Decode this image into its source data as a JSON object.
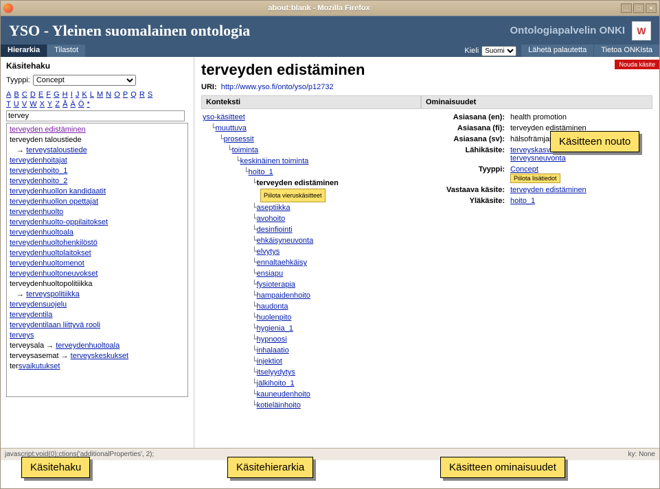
{
  "window": {
    "title": "about:blank - Mozilla Firefox"
  },
  "header": {
    "title": "YSO - Yleinen suomalainen ontologia",
    "server": "Ontologiapalvelin ONKI"
  },
  "nav": {
    "tabs": [
      {
        "label": "Hierarkia"
      },
      {
        "label": "Tilastot"
      }
    ],
    "lang_label": "Kieli",
    "lang_value": "Suomi",
    "right": [
      {
        "label": "Lähetä palautetta"
      },
      {
        "label": "Tietoa ONKIsta"
      }
    ]
  },
  "sidebar": {
    "title": "Käsitehaku",
    "type_label": "Tyyppi:",
    "type_value": "Concept",
    "alpha": [
      "A",
      "B",
      "C",
      "D",
      "E",
      "F",
      "G",
      "H",
      "I",
      "J",
      "K",
      "L",
      "M",
      "N",
      "O",
      "P",
      "Q",
      "R",
      "S",
      "T",
      "U",
      "V",
      "W",
      "X",
      "Y",
      "Z",
      "Å",
      "Ä",
      "Ö",
      "*"
    ],
    "search_value": "tervey",
    "results": [
      {
        "text": "terveyden edistäminen",
        "visited": true
      },
      {
        "text": "terveyden taloustiede",
        "plain": true
      },
      {
        "arrow": true,
        "text": "terveystaloustiede"
      },
      {
        "text": "terveydenhoitajat"
      },
      {
        "text": "terveydenhoito_1"
      },
      {
        "text": "terveydenhoito_2"
      },
      {
        "text": "terveydenhuollon kandidaatit"
      },
      {
        "text": "terveydenhuollon opettajat"
      },
      {
        "text": "terveydenhuolto"
      },
      {
        "text": "terveydenhuolto-oppilaitokset"
      },
      {
        "text": "terveydenhuoltoala"
      },
      {
        "text": "terveydenhuoltohenkilöstö"
      },
      {
        "text": "terveydenhuoltolaitokset"
      },
      {
        "text": "terveydenhuoltomenot"
      },
      {
        "text": "terveydenhuoltoneuvokset"
      },
      {
        "text": "terveydenhuoltopolitiikka",
        "plain": true
      },
      {
        "arrow": true,
        "text": "terveyspolitiikka"
      },
      {
        "text": "terveydensuojelu"
      },
      {
        "text": "terveydentila"
      },
      {
        "text": "terveydentilaan liittyvä rooli"
      },
      {
        "text": "terveys"
      },
      {
        "combo": "terveysala → ",
        "link": "terveydenhuoltoala"
      },
      {
        "combo": "terveysasemat → ",
        "link": "terveyskeskukset"
      },
      {
        "combo": "ter",
        "link": "svaikutukset",
        "cut": true
      }
    ]
  },
  "content": {
    "title": "terveyden edistäminen",
    "uri_label": "URI:",
    "uri": "http://www.yso.fi/onto/yso/p12732",
    "fetch_label": "Nouda käsite",
    "context_hdr": "Konteksti",
    "props_hdr": "Ominaisuudet",
    "hide_guest": "Piilota vieruskäsitteet",
    "hide_extra": "Piilota lisätiedot",
    "tree": {
      "root": "yso-käsitteet",
      "l1": "muuttuva",
      "l2": "prosessit",
      "l3": "toiminta",
      "l4": "keskinäinen toiminta",
      "l5": "hoito_1",
      "current": "terveyden edistäminen",
      "siblings": [
        "aseptiikka",
        "avohoito",
        "desinfiointi",
        "ehkäisyneuvonta",
        "elvytys",
        "ennaltaehkäisy",
        "ensiapu",
        "fysioterapia",
        "hampaidenhoito",
        "haudonta",
        "huolenpito",
        "hygienia_1",
        "hypnoosi",
        "inhalaatio",
        "injektiot",
        "itselyydytys",
        "jälkihoito_1",
        "kauneudenhoito",
        "kotieläinhoito"
      ]
    },
    "props": [
      {
        "label": "Asiasana (en):",
        "value": "health promotion"
      },
      {
        "label": "Asiasana (fi):",
        "value": "terveyden edistäminen"
      },
      {
        "label": "Asiasana (sv):",
        "value": "hälsofrämjande"
      },
      {
        "label": "Lähikäsite:",
        "links": [
          "terveyskasvatus",
          "terveysneuvonta"
        ]
      },
      {
        "label": "Tyyppi:",
        "links": [
          "Concept"
        ],
        "btn": true
      },
      {
        "label": "Vastaava käsite:",
        "links": [
          "terveyden edistäminen"
        ]
      },
      {
        "label": "Yläkäsite:",
        "links": [
          "hoito_1"
        ]
      }
    ]
  },
  "callouts": {
    "c1": "Käsitehaku",
    "c2": "Käsitehierarkia",
    "c3": "Käsitteen ominaisuudet",
    "c4": "Käsitteen nouto"
  },
  "status": {
    "left": "javascript:void(0);ctions('additionalProperties', 2);",
    "right": "ky: None"
  }
}
